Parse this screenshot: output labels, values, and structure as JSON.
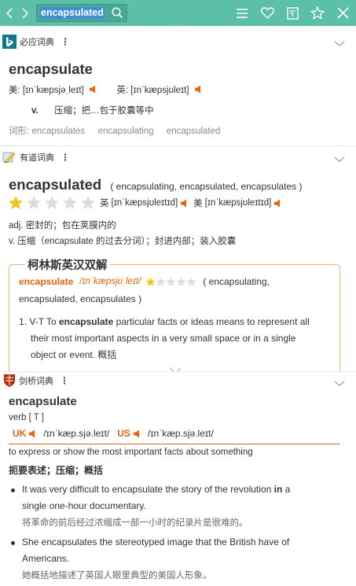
{
  "toolbar": {
    "query": "encapsulated",
    "back_icon": "back-arrow-icon",
    "forward_icon": "forward-arrow-icon",
    "icons": [
      "search-icon",
      "menu-icon",
      "heart-icon",
      "bookmark-icon",
      "star-icon",
      "close-icon"
    ]
  },
  "bing": {
    "name": "必应词典",
    "more": "⋮",
    "word": "encapsulate",
    "us_label": "美:",
    "us_ipa": "[ɪnˈkæpsjəˌleɪt]",
    "uk_label": "英:",
    "uk_ipa": "[ɪnˈkæpsjʊleɪt]",
    "pos": "v.",
    "def": "压缩；把…包于胶囊等中",
    "forms_label": "词形:",
    "forms": [
      "encapsulates",
      "encapsulating",
      "encapsulated"
    ]
  },
  "youdao": {
    "name": "有道词典",
    "more": "⋮",
    "word": "encapsulated",
    "inflections": "( encapsulating, encapsulated, encapsulates )",
    "rating": 1,
    "rating_max": 5,
    "uk_label": "英",
    "uk_ipa": "[ɪnˈkæpsjʊleɪtɪd]",
    "us_label": "美",
    "us_ipa": "[ɪnˈkæpsjʊleɪtɪd]",
    "def1": "adj. 密封的；包在荚膜内的",
    "def2": "v. 压缩（encapsulate 的过去分词）；封进内部；装入胶囊"
  },
  "collins": {
    "title": "柯林斯英汉双解",
    "word": "encapsulate",
    "ipa": "/ɪnˈkæpsjʊˌleɪt/",
    "rating": 1,
    "rating_max": 5,
    "inflections_1": "( encapsulating,",
    "inflections_2": "encapsulated, encapsulates )",
    "num": "1.",
    "sense_pre": "V-T To ",
    "sense_bold": "encapsulate",
    "sense_l1_rest": " particular facts or ideas means to represent all",
    "sense_l2": "their most important aspects in a very small space or in a single",
    "sense_l3": "object or event. 概括"
  },
  "cambridge": {
    "name": "剑桥词典",
    "more": "⋮",
    "word": "encapsulate",
    "pos": "verb",
    "gram": "[ T ]",
    "uk_label": "UK",
    "uk_ipa": "/ɪnˈkæp.sjə.leɪt/",
    "us_label": "US",
    "us_ipa": "/ɪnˈkæp.sjə.leɪt/",
    "def_en": "to express or show the most important facts about something",
    "def_zh": "扼要表述；压缩；概括",
    "ex1_l1_pre": "It was very difficult to encapsulate the story of the revolution ",
    "ex1_l1_bold": "in",
    "ex1_l1_post": " a",
    "ex1_l2": "single one-hour documentary.",
    "ex1_zh": "将革命的前后经过浓缩成一部一小时的纪录片是很难的。",
    "ex2_l1": "She encapsulates the stereotyped image that the British have of",
    "ex2_l2": "Americans.",
    "ex2_zh": "她概括地描述了英国人眼里典型的美国人形象。"
  },
  "colors": {
    "topbar": "#5cbfa8",
    "accent": "#e8630a",
    "star": "#f5c518"
  }
}
